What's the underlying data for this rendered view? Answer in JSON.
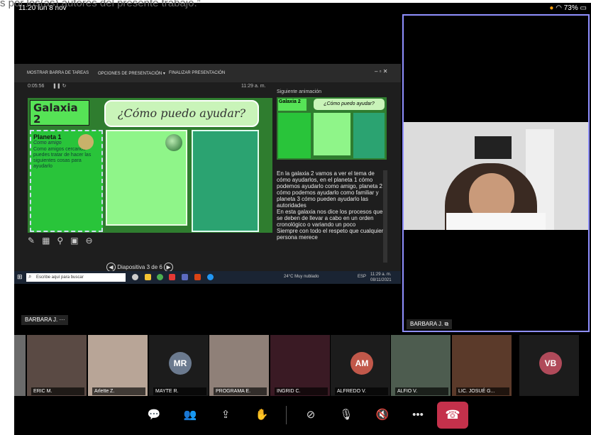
{
  "caption": "s por los(as) autores del presente trabajo.”",
  "status_bar": {
    "time": "11:20",
    "date": "lun 8 nov",
    "battery": "73%"
  },
  "share": {
    "toolbar": {
      "taskbar": "MOSTRAR BARRA DE TAREAS",
      "options": "OPCIONES DE PRESENTACIÓN ▾",
      "finish": "FINALIZAR PRESENTACIÓN"
    },
    "timer": "0:05:56",
    "clock": "11:29 a. m.",
    "slide": {
      "galaxy_title": "Galaxia 2",
      "question": "¿Cómo puedo ayudar?",
      "planet1_title": "Planeta 1",
      "planet1_sub": "Como amigo",
      "planet1_text": "Como amigos cercanos puedes tratar de hacer las siguientes cosas para ayudarlo"
    },
    "slide_counter": "Diapositiva 3 de 6",
    "next_label": "Siguiente animación",
    "notes": [
      "En la galaxia 2 vamos a ver el tema de cómo ayudarlos, en el planeta 1 cómo podemos ayudarlo como amigo, planeta 2 cómo podemos ayudarlo como familiar y planeta 3 cómo pueden ayudarlo las autoridades",
      "En esta galaxia nos dice los procesos que se deben de llevar a cabo en un orden cronológico o variando un poco",
      "Siempre con todo el respeto que cualquier persona merece"
    ],
    "taskbar": {
      "search": "Escribe aquí para buscar",
      "weather": "24°C Muy nublado",
      "lang": "ESP",
      "time": "11:29 a. m.",
      "date": "08/11/2021"
    }
  },
  "self_tag": "BARBARA J.",
  "speaker_tag": "BARBARA J.",
  "participants": [
    {
      "name": "",
      "initials": ""
    },
    {
      "name": "ERIC M.",
      "initials": ""
    },
    {
      "name": "Arlette Z.",
      "initials": ""
    },
    {
      "name": "MAYTE R.",
      "initials": "MR"
    },
    {
      "name": "PROGRAMA E.",
      "initials": ""
    },
    {
      "name": "INGRID C.",
      "initials": ""
    },
    {
      "name": "ALFREDO V.",
      "initials": "AM"
    },
    {
      "name": "ALFIO V.",
      "initials": ""
    },
    {
      "name": "LIC. JOSUÉ G...",
      "initials": ""
    },
    {
      "name": "",
      "initials": "VB"
    }
  ],
  "colors": {
    "hangup": "#c4314b",
    "speaker_border": "#8f8fff",
    "slide_bg": "#2f7d2f"
  },
  "icons": [
    "chat-icon",
    "people-icon",
    "share-icon",
    "raise-hand-icon",
    "camera-off-icon",
    "mic-off-icon",
    "speaker-off-icon",
    "more-icon",
    "hangup-icon"
  ]
}
